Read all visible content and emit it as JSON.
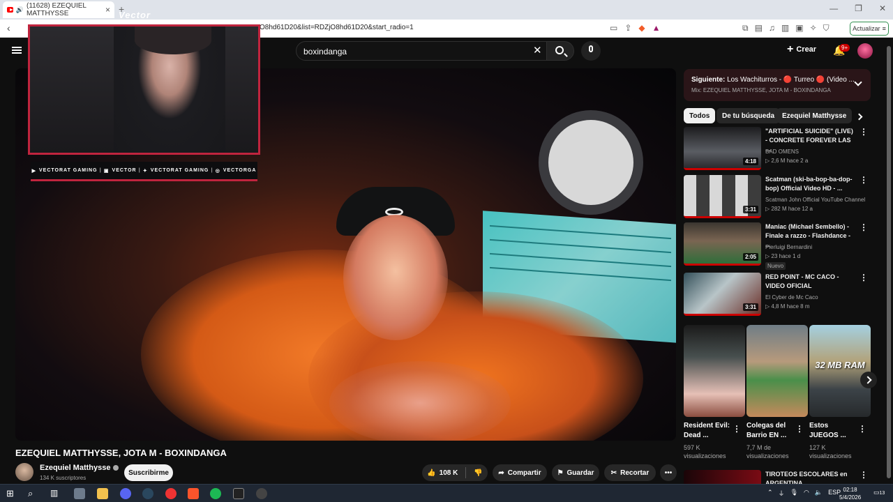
{
  "browser": {
    "tab_title": "(11628) EZEQUIEL MATTHYSSE",
    "url": "O8hd61D20&list=RDZjO8hd61D20&start_radio=1",
    "update_button": "Actualizar"
  },
  "header": {
    "search_value": "boxindanga",
    "create_label": "Crear",
    "notifications_badge": "9+"
  },
  "overlay": {
    "watermark": "Vector",
    "socials": [
      "VECTORAT GAMING",
      "VECTOR",
      "VECTORAT GAMING",
      "VECTORGA"
    ]
  },
  "video": {
    "title": "EZEQUIEL MATTHYSSE, JOTA M - BOXINDANGA",
    "channel": "Ezequiel Matthysse",
    "subscribers": "134 K suscriptores",
    "subscribe_label": "Suscribirme",
    "likes": "108 K",
    "share_label": "Compartir",
    "save_label": "Guardar",
    "clip_label": "Recortar"
  },
  "sidebar": {
    "next_prefix": "Siguiente:",
    "next_title": "Los Wachiturros - 🔴 Turreo 🔴 (Video ...",
    "next_subtitle": "Mix: EZEQUIEL MATTHYSSE, JOTA M - BOXINDANGA",
    "chips": [
      "Todos",
      "De tu búsqueda",
      "Ezequiel Matthysse"
    ],
    "recommendations": [
      {
        "title": "\"ARTIFICIAL SUICIDE\" (LIVE) - CONCRETE FOREVER LAS ...",
        "channel": "BAD OMENS",
        "meta": "▷ 2,6 M   hace 2 a",
        "duration": "4:18"
      },
      {
        "title": "Scatman (ski-ba-bop-ba-dop-bop) Official Video HD - ...",
        "channel": "Scatman John Official YouTube Channel",
        "meta": "▷ 282 M   hace 12 a",
        "duration": "3:31"
      },
      {
        "title": "Maniac (Michael Sembello) - Finale a razzo - Flashdance - ...",
        "channel": "Pierluigi Bernardini",
        "meta": "▷ 23   hace 1 d",
        "duration": "2:05",
        "badge": "Nuevo"
      },
      {
        "title": "RED POINT - MC CACO - VIDEO OFICIAL",
        "channel": "El Cyber de Mc Caco",
        "meta": "▷ 4,8 M   hace 8 m",
        "duration": "3:31"
      }
    ],
    "shorts": [
      {
        "title": "Resident Evil: Dead ...",
        "views": "597 K visualizaciones"
      },
      {
        "title": "Colegas del Barrio EN ...",
        "views": "7,7 M de visualizaciones"
      },
      {
        "title": "Estos JUEGOS ...",
        "views": "127 K visualizaciones",
        "overlay_text": "32 MB RAM"
      }
    ],
    "last_title": "TIROTEOS ESCOLARES en ARGENTINA"
  },
  "taskbar": {
    "lang": "ESP",
    "time": "02:18",
    "date": "5/4/2026",
    "notif_count": "13"
  }
}
